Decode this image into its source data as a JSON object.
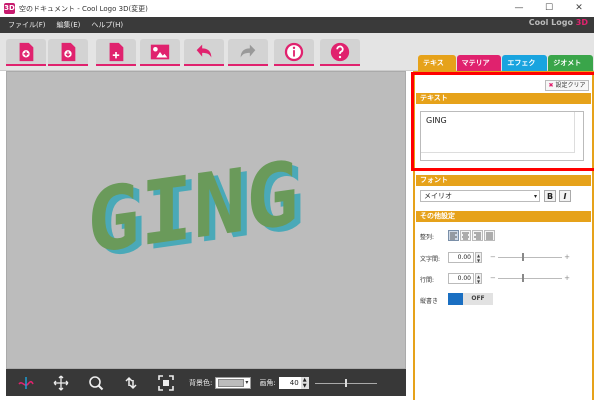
{
  "window": {
    "title": "空のドキュメント - Cool Logo 3D(変更)",
    "icon_label": "3D",
    "minimize": "—",
    "maximize": "☐",
    "close": "✕"
  },
  "menu": {
    "items": [
      "ファイル(F)",
      "編集(E)",
      "ヘルプ(H)"
    ],
    "brand": "Cool Logo",
    "brand_3d": "3D"
  },
  "toolbar": {
    "buttons": [
      "new-document",
      "open-document",
      "save-document",
      "insert-image",
      "undo",
      "redo",
      "info",
      "help"
    ]
  },
  "viewport": {
    "text": "GING",
    "text_color": "#6a9a5a",
    "side_color": "#4aa9b8",
    "background": "#bcbcbc"
  },
  "bottombar": {
    "bg_color_label": "背景色:",
    "angle_label": "画角:",
    "angle_value": "40"
  },
  "tabs": [
    "テキスト",
    "マテリアル",
    "エフェクト",
    "ジオメトリ"
  ],
  "panel": {
    "clear_label": "設定クリア",
    "text_section": "テキスト",
    "text_value": "GING",
    "font_section": "フォント",
    "font_value": "メイリオ",
    "bold_label": "B",
    "italic_label": "I",
    "other_section": "その他設定",
    "align_label": "整列:",
    "char_spacing_label": "文字間:",
    "char_spacing_value": "0.00",
    "line_spacing_label": "行間:",
    "line_spacing_value": "0.00",
    "vertical_label": "縦書き",
    "vertical_state": "OFF"
  },
  "colors": {
    "accent_orange": "#e6a21a",
    "accent_pink": "#e0226e",
    "accent_blue": "#19a4df",
    "accent_green": "#3aa54a",
    "highlight_red": "#ff0000"
  }
}
